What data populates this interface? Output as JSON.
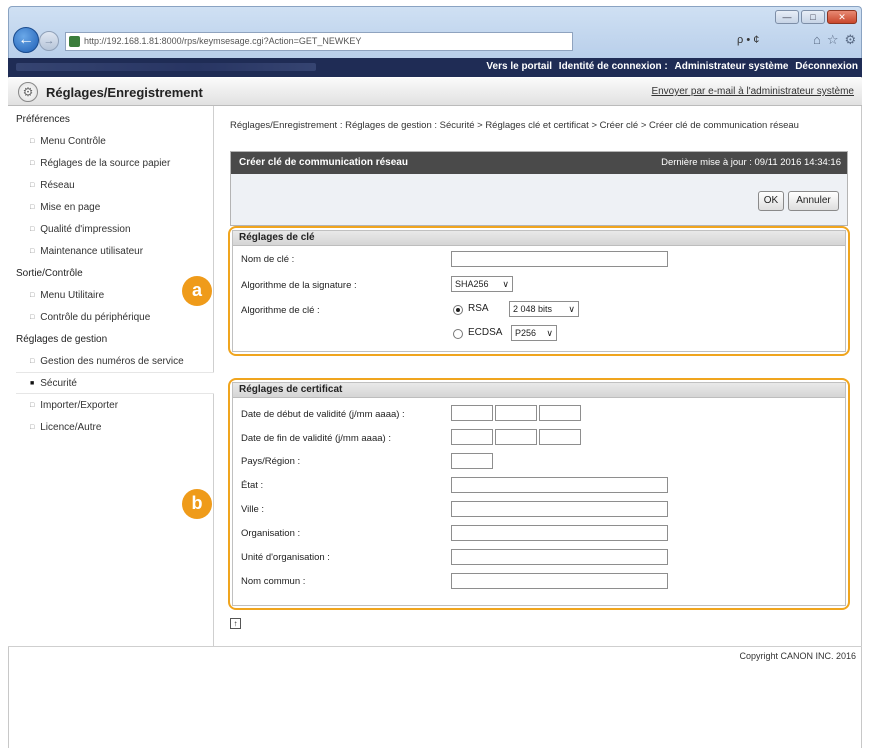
{
  "browser": {
    "url": "http://192.168.1.81:8000/rps/keymsesage.cgi?Action=GET_NEWKEY",
    "search_hint": "ρ • ¢",
    "window_buttons": [
      "—",
      "□",
      "✕"
    ],
    "toolbar_icons": [
      "home-icon",
      "star-icon",
      "gear-icon"
    ]
  },
  "topbar": {
    "portal": "Vers le portail",
    "login_label": "Identité de connexion :",
    "admin": "Administrateur système",
    "logout": "Déconnexion"
  },
  "titlebar": {
    "title": "Réglages/Enregistrement",
    "mail_link": "Envoyer par e-mail à l'administrateur système"
  },
  "sidebar": {
    "sections": [
      {
        "label": "Préférences",
        "items": [
          "Menu Contrôle",
          "Réglages de la source papier",
          "Réseau",
          "Mise en page",
          "Qualité d'impression",
          "Maintenance utilisateur"
        ]
      },
      {
        "label": "Sortie/Contrôle",
        "items": [
          "Menu Utilitaire",
          "Contrôle du périphérique"
        ]
      },
      {
        "label": "Réglages de gestion",
        "items": [
          "Gestion des numéros de service",
          "Sécurité",
          "Importer/Exporter",
          "Licence/Autre"
        ]
      }
    ],
    "active_item": "Sécurité"
  },
  "main": {
    "breadcrumb": "Réglages/Enregistrement : Réglages de gestion : Sécurité > Réglages clé et certificat > Créer clé > Créer clé de communication réseau",
    "card_title": "Créer clé de communication réseau",
    "last_update": "Dernière mise à jour : 09/11 2016 14:34:16",
    "ok_label": "OK",
    "cancel_label": "Annuler"
  },
  "key_settings": {
    "heading": "Réglages de clé",
    "key_name_label": "Nom de clé :",
    "key_name_value": "",
    "signature_label": "Algorithme de la signature :",
    "signature_value": "SHA256",
    "key_algo_label": "Algorithme de clé :",
    "rsa_label": "RSA",
    "rsa_bits": "2 048 bits",
    "ecdsa_label": "ECDSA",
    "ecdsa_value": "P256",
    "selected_algorithm": "RSA"
  },
  "cert_settings": {
    "heading": "Réglages de certificat",
    "start_label": "Date de début de validité (j/mm aaaa) :",
    "end_label": "Date de fin de validité (j/mm aaaa) :",
    "country_label": "Pays/Région :",
    "state_label": "État :",
    "city_label": "Ville :",
    "org_label": "Organisation :",
    "unit_label": "Unité d'organisation :",
    "common_label": "Nom commun :"
  },
  "badges": {
    "a": "a",
    "b": "b"
  },
  "footer": {
    "copyright": "Copyright CANON INC. 2016"
  },
  "colors": {
    "accent": "#f0a51e",
    "header_bg": "#1f2c55",
    "card_head": "#4a4a4a"
  }
}
